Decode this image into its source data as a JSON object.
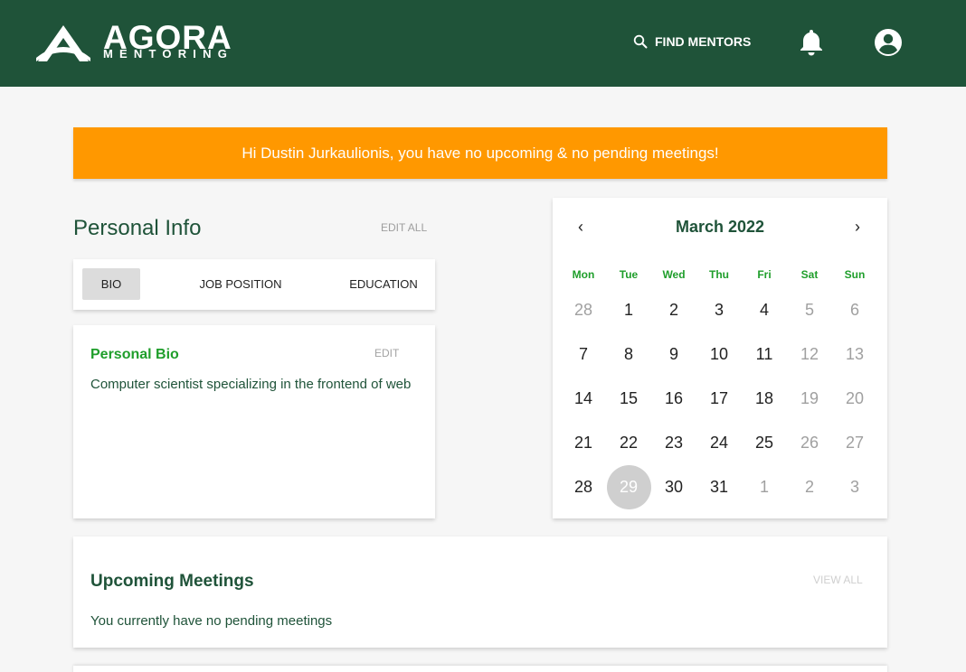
{
  "header": {
    "logo_name": "AGORA",
    "logo_sub": "MENTORING",
    "find_mentors": "FIND MENTORS",
    "icons": [
      "search-icon",
      "bell-icon",
      "account-circle-icon"
    ]
  },
  "banner": {
    "text": "Hi Dustin Jurkaulionis, you have no upcoming & no pending meetings!",
    "color": "#ff9800"
  },
  "personal_info": {
    "title": "Personal Info",
    "edit_all": "EDIT ALL",
    "tabs": [
      {
        "label": "BIO",
        "active": true
      },
      {
        "label": "JOB POSITION",
        "active": false
      },
      {
        "label": "EDUCATION",
        "active": false
      }
    ],
    "bio": {
      "title": "Personal Bio",
      "edit": "EDIT",
      "text": "Computer scientist specializing in the frontend of web"
    }
  },
  "calendar": {
    "month": "March 2022",
    "prev": "‹",
    "next": "›",
    "weekdays": [
      "Mon",
      "Tue",
      "Wed",
      "Thu",
      "Fri",
      "Sat",
      "Sun"
    ],
    "weeks": [
      [
        "28",
        "1",
        "2",
        "3",
        "4",
        "5",
        "6"
      ],
      [
        "7",
        "8",
        "9",
        "10",
        "11",
        "12",
        "13"
      ],
      [
        "14",
        "15",
        "16",
        "17",
        "18",
        "19",
        "20"
      ],
      [
        "21",
        "22",
        "23",
        "24",
        "25",
        "26",
        "27"
      ],
      [
        "28",
        "29",
        "30",
        "31",
        "1",
        "2",
        "3"
      ]
    ],
    "selected_day": "29"
  },
  "meetings": {
    "title": "Upcoming Meetings",
    "view_all": "VIEW ALL",
    "empty": "You currently have no pending meetings"
  },
  "colors": {
    "primary": "#1f5339",
    "accent_green": "#1f9e2b",
    "banner": "#ff9800"
  }
}
